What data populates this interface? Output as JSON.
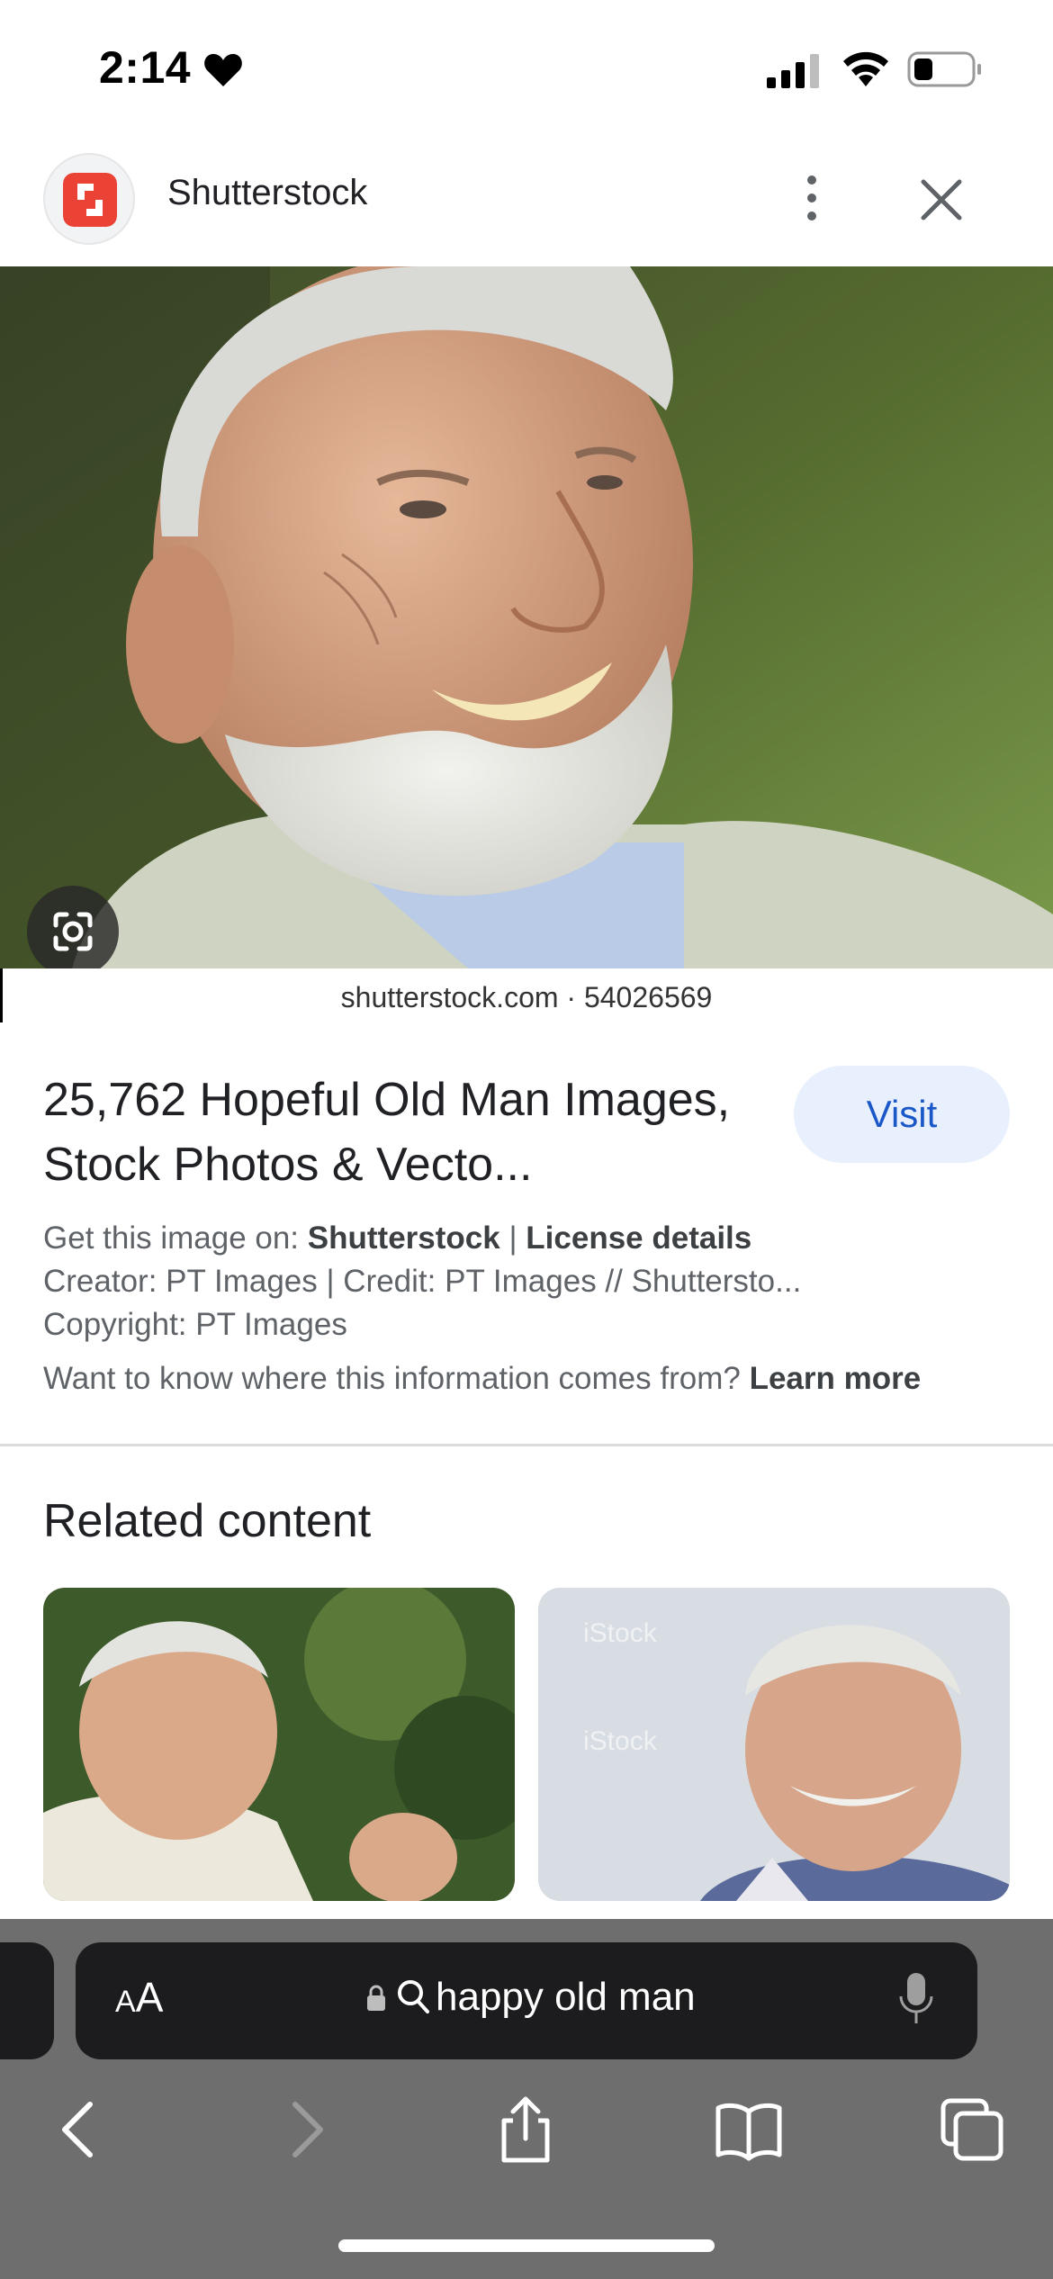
{
  "status_bar": {
    "time": "2:14"
  },
  "source": {
    "name": "Shutterstock",
    "brand_color": "#ea4335"
  },
  "image": {
    "watermark": "shutterstock.com · 54026569"
  },
  "result": {
    "title": "25,762 Hopeful Old Man Images, Stock Photos & Vecto...",
    "visit_label": "Visit",
    "get_image_prefix": "Get this image on:",
    "get_image_source": "Shutterstock",
    "separator": "|",
    "license_label": "License details",
    "creator_line": "Creator: PT Images | Credit: PT Images // Shuttersto...",
    "copyright_line": "Copyright: PT Images",
    "info_question": "Want to know where this information comes from?",
    "learn_more_label": "Learn more"
  },
  "related": {
    "heading": "Related content",
    "thumb_watermark": "iStock"
  },
  "browser": {
    "aa_label_small": "A",
    "aa_label_large": "A",
    "address_text": "happy old man"
  },
  "colors": {
    "visit_bg": "#e8f0fe",
    "visit_text": "#1a57c8",
    "toolbar_bg": "#6e6e6e",
    "address_bg": "#1c1c1e"
  }
}
